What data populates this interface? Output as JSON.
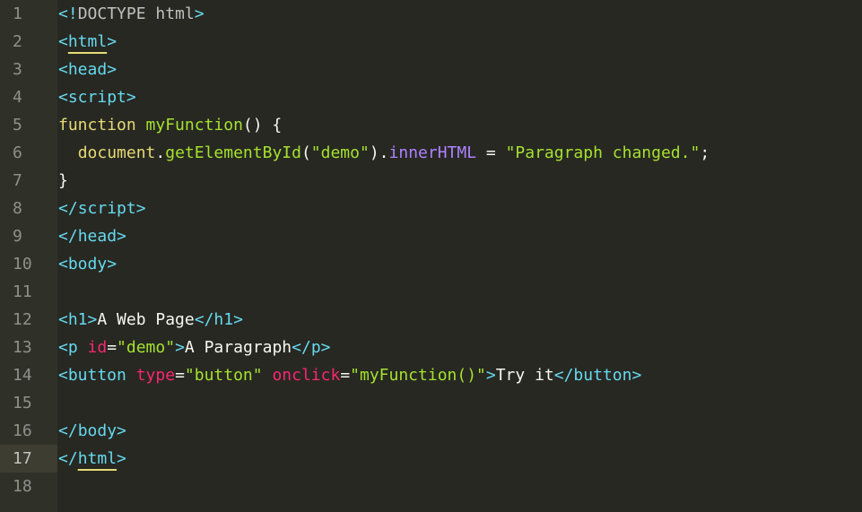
{
  "editor": {
    "theme_colors": {
      "background": "#272822",
      "gutter": "#2f3129",
      "tag": "#66d9ef",
      "attribute": "#f92672",
      "string": "#a6e22e",
      "text": "#f8f8f2",
      "property": "#ae81ff",
      "object": "#e6db74"
    },
    "active_line": 17,
    "lines": [
      {
        "num": "1"
      },
      {
        "num": "2"
      },
      {
        "num": "3"
      },
      {
        "num": "4"
      },
      {
        "num": "5"
      },
      {
        "num": "6"
      },
      {
        "num": "7"
      },
      {
        "num": "8"
      },
      {
        "num": "9"
      },
      {
        "num": "10"
      },
      {
        "num": "11"
      },
      {
        "num": "12"
      },
      {
        "num": "13"
      },
      {
        "num": "14"
      },
      {
        "num": "15"
      },
      {
        "num": "16"
      },
      {
        "num": "17"
      },
      {
        "num": "18"
      }
    ]
  },
  "code": {
    "l1": {
      "open": "<!",
      "word": "DOCTYPE html",
      "close": ">"
    },
    "l2": {
      "lt": "<",
      "name": "html",
      "gt": ">"
    },
    "l3": {
      "lt": "<",
      "name": "head",
      "gt": ">"
    },
    "l4": {
      "lt": "<",
      "name": "script",
      "gt": ">"
    },
    "l5": {
      "kw": "function ",
      "fn": "myFunction",
      "rest": "() {"
    },
    "l6": {
      "indent": "  ",
      "obj": "document",
      "dot": ".",
      "meth": "getElementById",
      "p1": "(",
      "arg": "\"demo\"",
      "p2": ").",
      "prop": "innerHTML",
      "eq": " = ",
      "val": "\"Paragraph changed.\"",
      "semi": ";"
    },
    "l7": {
      "text": "}"
    },
    "l8": {
      "lt": "</",
      "name": "script",
      "gt": ">"
    },
    "l9": {
      "lt": "</",
      "name": "head",
      "gt": ">"
    },
    "l10": {
      "lt": "<",
      "name": "body",
      "gt": ">"
    },
    "l11": {
      "text": ""
    },
    "l12": {
      "open": "<h1>",
      "text": "A Web Page",
      "close": "</h1>"
    },
    "l13": {
      "lt": "<p ",
      "attr": "id",
      "eq": "=",
      "val": "\"demo\"",
      "gt": ">",
      "text": "A Paragraph",
      "close": "</p>"
    },
    "l14": {
      "lt": "<button ",
      "attr1": "type",
      "eq1": "=",
      "val1": "\"button\"",
      "sp": " ",
      "attr2": "onclick",
      "eq2": "=",
      "val2": "\"myFunction()\"",
      "gt": ">",
      "text": "Try it",
      "close": "</button>"
    },
    "l15": {
      "text": ""
    },
    "l16": {
      "lt": "</",
      "name": "body",
      "gt": ">"
    },
    "l17": {
      "lt": "</",
      "name": "html",
      "gt": ">"
    },
    "l18": {
      "text": ""
    }
  }
}
